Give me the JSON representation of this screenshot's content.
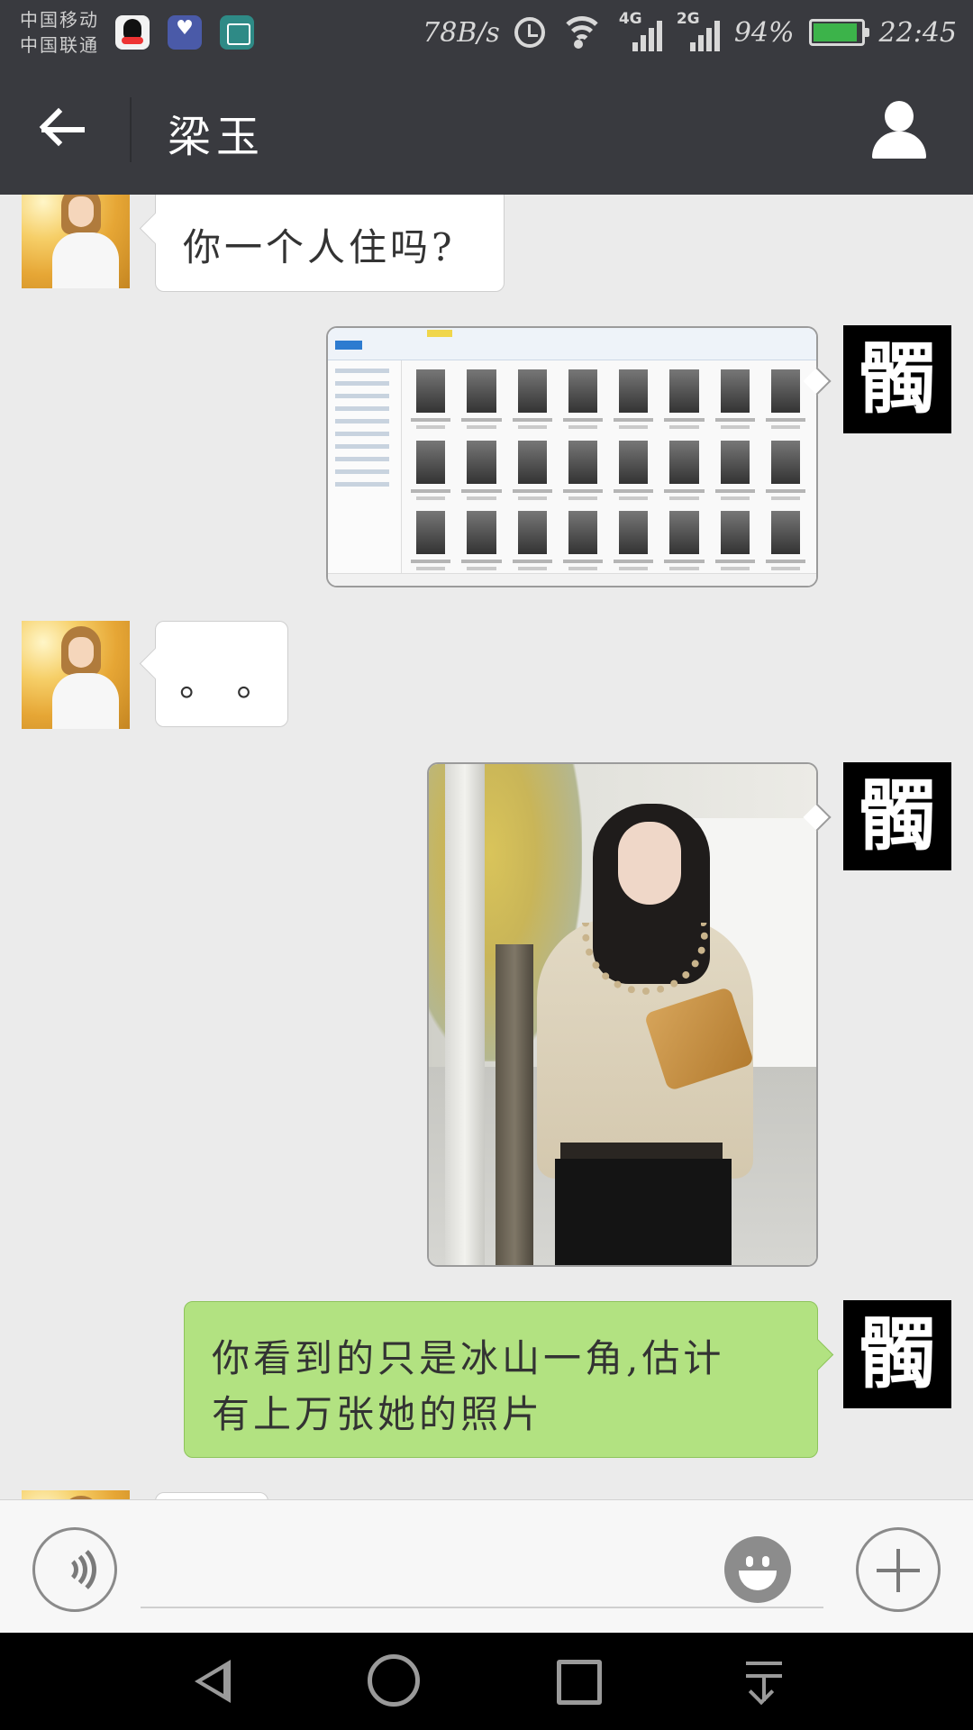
{
  "status_bar": {
    "carrier_1": "中国移动",
    "carrier_2": "中国联通",
    "notification_icons": [
      "qq-icon",
      "health-icon",
      "gallery-icon"
    ],
    "network_speed": "78B/s",
    "sim1_network": "4G",
    "sim2_network": "2G",
    "battery_percent": "94%",
    "battery_level": 0.94,
    "time": "22:45"
  },
  "header": {
    "title": "梁玉",
    "back_icon": "arrow-left-icon",
    "profile_icon": "person-icon"
  },
  "contact_avatar": {
    "type": "photo"
  },
  "self_avatar": {
    "glyph": "髑"
  },
  "messages": [
    {
      "direction": "in",
      "kind": "text",
      "text": "你一个人住吗?"
    },
    {
      "direction": "out",
      "kind": "image",
      "description_icon": "explorer-screenshot"
    },
    {
      "direction": "in",
      "kind": "text",
      "text": "。 。"
    },
    {
      "direction": "out",
      "kind": "image",
      "description_icon": "photo"
    },
    {
      "direction": "out",
      "kind": "text",
      "text_line_1": "你看到的只是冰山一角,估计",
      "text_line_2": "有上万张她的照片"
    }
  ],
  "input_bar": {
    "voice_icon": "voice-icon",
    "input_value": "",
    "emoji_icon": "smiley-icon",
    "more_icon": "plus-icon"
  },
  "colors": {
    "header_bg": "#393a3f",
    "chat_bg": "#ebebeb",
    "outgoing_bubble": "#b2e281",
    "incoming_bubble": "#ffffff"
  }
}
